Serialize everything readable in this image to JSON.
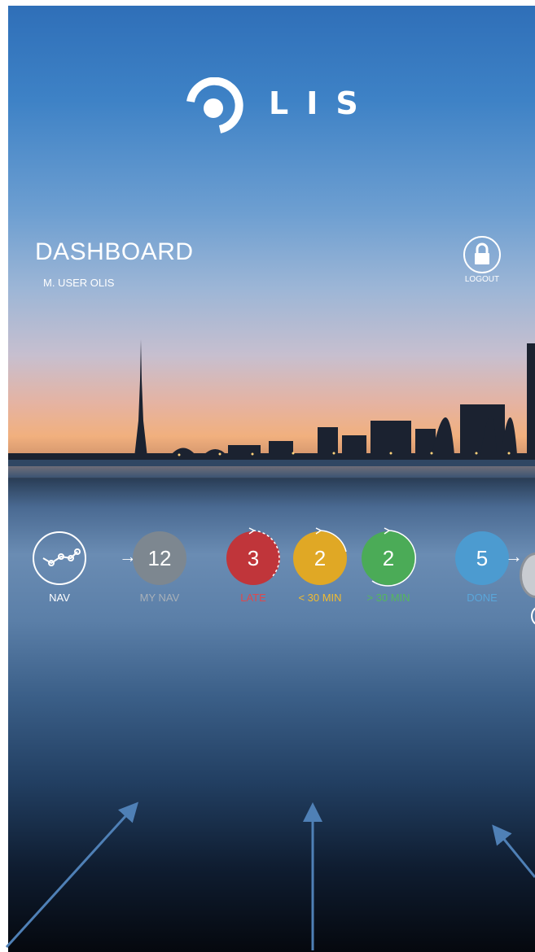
{
  "header": {
    "logo_text": "LIS"
  },
  "dashboard": {
    "title": "DASHBOARD",
    "user": "M. USER OLIS"
  },
  "logout": {
    "label": "LOGOUT"
  },
  "stats": {
    "nav": {
      "label": "NAV"
    },
    "my_nav": {
      "value": "12",
      "label": "MY NAV",
      "color": "#7d8790",
      "label_color": "#a8b0b8"
    },
    "late": {
      "value": "3",
      "label": "LATE",
      "color": "#c0353a",
      "label_color": "#e0484b"
    },
    "lt30": {
      "value": "2",
      "label": "< 30 MIN",
      "color": "#e0a825",
      "label_color": "#f2bc2f"
    },
    "gt30": {
      "value": "2",
      "label": "> 30 MIN",
      "color": "#4bab57",
      "label_color": "#55b85c"
    },
    "done": {
      "value": "5",
      "label": "DONE",
      "color": "#4c9bd0",
      "label_color": "#5aa6da"
    }
  },
  "colors": {
    "annotation_arrow": "#4f80b6"
  }
}
